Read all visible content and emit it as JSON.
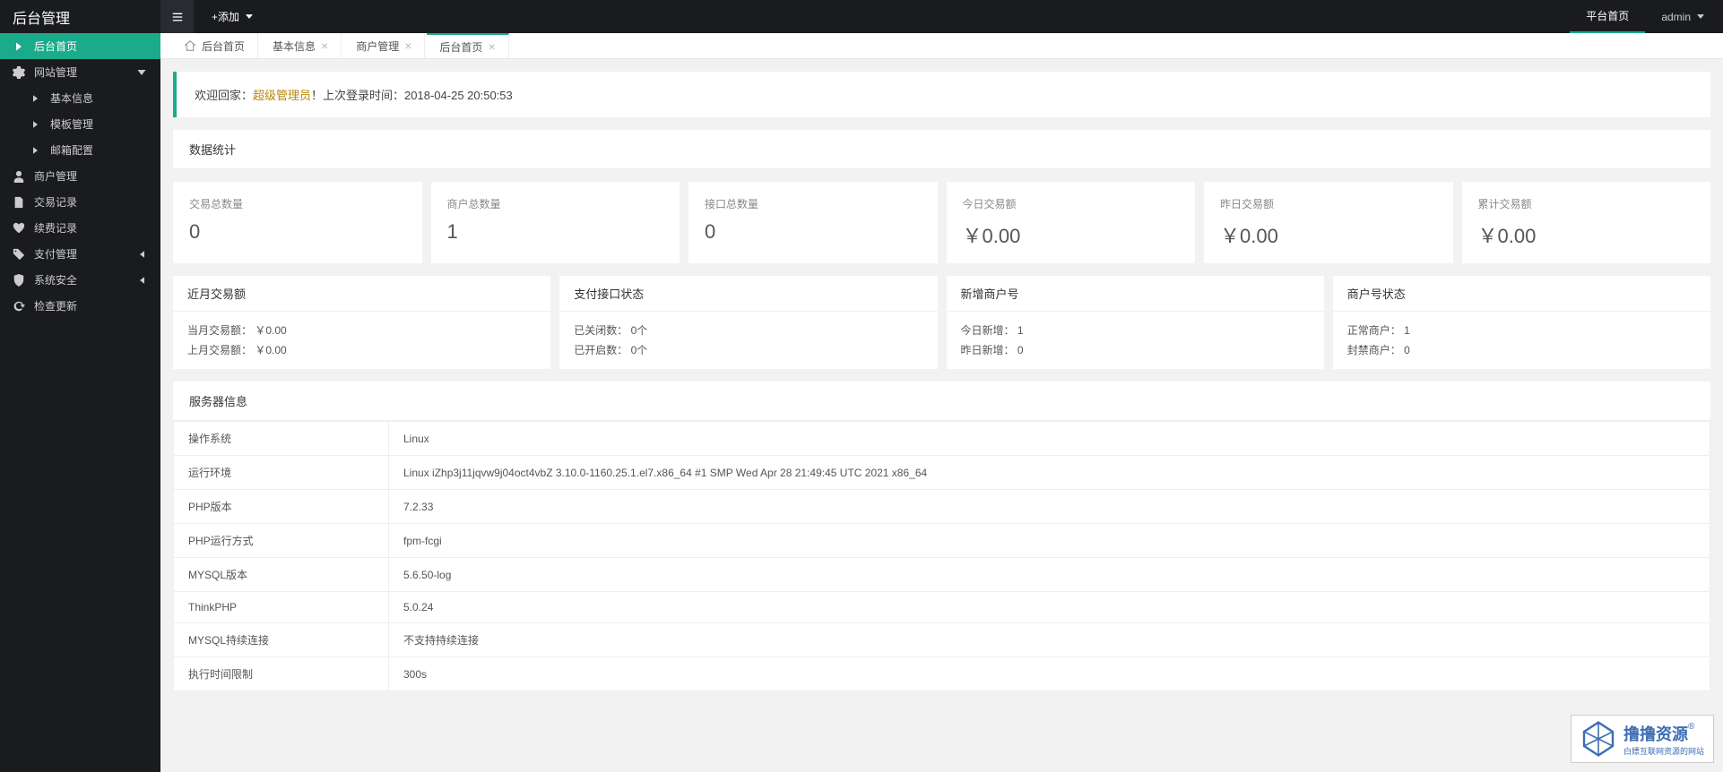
{
  "topbar": {
    "title": "后台管理",
    "add_label": "+添加",
    "platform_home": "平台首页",
    "user": "admin"
  },
  "sidebar": {
    "items": [
      {
        "label": "后台首页",
        "icon": "chevron-right"
      },
      {
        "label": "网站管理",
        "icon": "gear",
        "expandable": true
      },
      {
        "label": "基本信息",
        "icon": "chevron-right",
        "sub": true
      },
      {
        "label": "模板管理",
        "icon": "chevron-right",
        "sub": true
      },
      {
        "label": "邮箱配置",
        "icon": "chevron-right",
        "sub": true
      },
      {
        "label": "商户管理",
        "icon": "user"
      },
      {
        "label": "交易记录",
        "icon": "doc"
      },
      {
        "label": "续费记录",
        "icon": "heart"
      },
      {
        "label": "支付管理",
        "icon": "tag",
        "expandable": true
      },
      {
        "label": "系统安全",
        "icon": "shield",
        "expandable": true
      },
      {
        "label": "检查更新",
        "icon": "refresh"
      }
    ]
  },
  "tabs": [
    {
      "label": "后台首页",
      "closable": false,
      "home": true
    },
    {
      "label": "基本信息",
      "closable": true
    },
    {
      "label": "商户管理",
      "closable": true
    },
    {
      "label": "后台首页",
      "closable": true,
      "active": true
    }
  ],
  "welcome": {
    "prefix": "欢迎回家：",
    "role": "超级管理员",
    "suffix": "！上次登录时间：",
    "time": "2018-04-25 20:50:53"
  },
  "stats_header": "数据统计",
  "stats": [
    {
      "label": "交易总数量",
      "value": "0"
    },
    {
      "label": "商户总数量",
      "value": "1"
    },
    {
      "label": "接口总数量",
      "value": "0"
    },
    {
      "label": "今日交易额",
      "value": "￥0.00"
    },
    {
      "label": "昨日交易额",
      "value": "￥0.00"
    },
    {
      "label": "累计交易额",
      "value": "￥0.00"
    }
  ],
  "info_cards": [
    {
      "title": "近月交易额",
      "lines": [
        "当月交易额： ￥0.00",
        "上月交易额： ￥0.00"
      ]
    },
    {
      "title": "支付接口状态",
      "lines": [
        "已关闭数： 0个",
        "已开启数： 0个"
      ]
    },
    {
      "title": "新增商户号",
      "lines": [
        "今日新增： 1",
        "昨日新增： 0"
      ]
    },
    {
      "title": "商户号状态",
      "lines": [
        "正常商户： 1",
        "封禁商户： 0"
      ]
    }
  ],
  "server_header": "服务器信息",
  "server_rows": [
    {
      "k": "操作系统",
      "v": "Linux"
    },
    {
      "k": "运行环境",
      "v": "Linux iZhp3j11jqvw9j04oct4vbZ 3.10.0-1160.25.1.el7.x86_64 #1 SMP Wed Apr 28 21:49:45 UTC 2021 x86_64"
    },
    {
      "k": "PHP版本",
      "v": "7.2.33"
    },
    {
      "k": "PHP运行方式",
      "v": "fpm-fcgi"
    },
    {
      "k": "MYSQL版本",
      "v": "5.6.50-log"
    },
    {
      "k": "ThinkPHP",
      "v": "5.0.24"
    },
    {
      "k": "MYSQL持续连接",
      "v": "不支持持续连接"
    },
    {
      "k": "执行时间限制",
      "v": "300s"
    }
  ],
  "watermark": {
    "main": "撸撸资源",
    "reg": "®",
    "sub": "白嫖互联网资源的网站"
  }
}
